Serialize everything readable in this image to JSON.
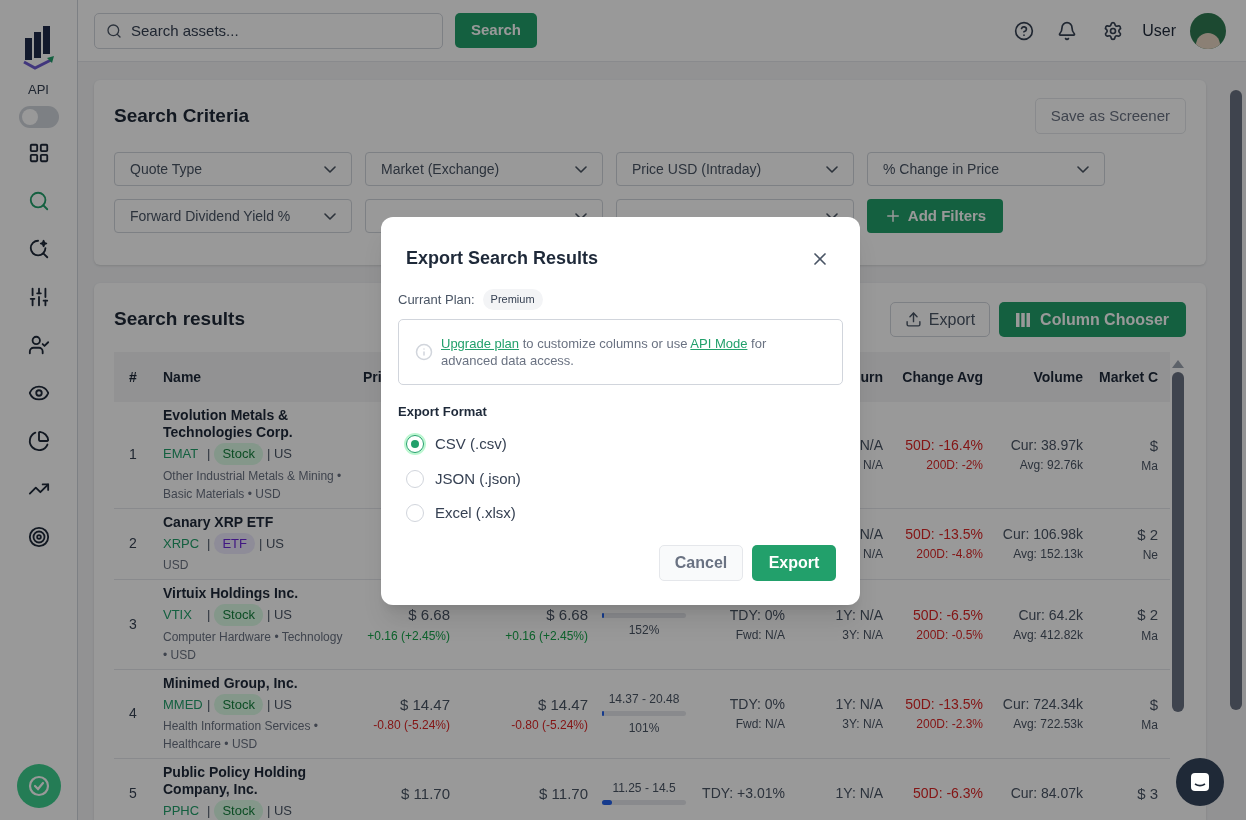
{
  "sidebar": {
    "api_label": "API",
    "api_toggle": {
      "on": false
    },
    "nav": [
      {
        "kind": "grid",
        "selected": false
      },
      {
        "kind": "search",
        "selected": true
      },
      {
        "kind": "search-sparkle",
        "selected": false
      },
      {
        "kind": "sliders",
        "selected": false
      },
      {
        "kind": "user-check",
        "selected": false
      },
      {
        "kind": "eye",
        "selected": false
      },
      {
        "kind": "pie",
        "selected": false
      },
      {
        "kind": "trend",
        "selected": false
      },
      {
        "kind": "target",
        "selected": false
      }
    ]
  },
  "topbar": {
    "search": {
      "placeholder": "Search assets..."
    },
    "search_button": "Search",
    "user": "User"
  },
  "criteria": {
    "title": "Search Criteria",
    "save_button": {
      "label": "Save as Screener",
      "disabled": true
    },
    "filters": [
      {
        "kind": "dropdown",
        "label": "Quote Type"
      },
      {
        "kind": "dropdown",
        "label": "Market (Exchange)"
      },
      {
        "kind": "dropdown",
        "label": "Price USD (Intraday)"
      },
      {
        "kind": "dropdown",
        "label": "% Change in Price"
      },
      {
        "kind": "dropdown",
        "label": "Forward Dividend Yield %"
      },
      {
        "kind": "dropdown"
      },
      {
        "kind": "dropdown"
      }
    ],
    "add_button": "Add Filters"
  },
  "results": {
    "title": "Search results",
    "export_button": "Export",
    "chooser_button": "Column Chooser",
    "columns": [
      "#",
      "Name",
      "Pri",
      "urn",
      "Change Avg",
      "Volume",
      "Market C"
    ],
    "rows": [
      {
        "num": "1",
        "name": "Evolution Metals & Technologies Corp.",
        "ticker": "EMAT",
        "sep": "|",
        "type": {
          "label": "Stock",
          "kind": "stock"
        },
        "country": "| US",
        "sector": "Other Industrial Metals & Mining • Basic Materials • USD",
        "return": {
          "y1": "N/A",
          "y3": "N/A"
        },
        "change_avg": {
          "d50": "50D: -16.4%",
          "d200": "200D: -2%",
          "kind": "loss"
        },
        "volume": {
          "cur": "Cur: 38.97k",
          "avg": "Avg: 92.76k"
        },
        "market_cap": {
          "value": "$",
          "sub": "Ma"
        }
      },
      {
        "num": "2",
        "name": "Canary XRP ETF",
        "ticker": "XRPC",
        "sep": "|",
        "type": {
          "label": "ETF",
          "kind": "etf"
        },
        "country": "| US",
        "sector": "USD",
        "return": {
          "y1": "N/A",
          "y3": "N/A"
        },
        "change_avg": {
          "d50": "50D: -13.5%",
          "d200": "200D: -4.8%",
          "kind": "loss"
        },
        "volume": {
          "cur": "Cur: 106.98k",
          "avg": "Avg: 152.13k"
        },
        "market_cap": {
          "value": "$ 2",
          "sub": "Ne"
        }
      },
      {
        "num": "3",
        "name": "Virtuix Holdings Inc.",
        "ticker": "VTIX",
        "sep": "|",
        "type": {
          "label": "Stock",
          "kind": "stock"
        },
        "country": "| US",
        "sector": "Computer Hardware • Technology • USD",
        "price": {
          "value": "$ 6.68",
          "change": "+0.16 (+2.45%)",
          "kind": "gain"
        },
        "price2": {
          "value": "$ 6.68",
          "change": "+0.16 (+2.45%)",
          "kind": "gain"
        },
        "range": {
          "level": 0.02,
          "pct": "152%"
        },
        "dividend": {
          "tdy": "TDY: 0%",
          "fwd": "Fwd: N/A"
        },
        "return": {
          "y1": "1Y: N/A",
          "y3": "3Y: N/A"
        },
        "change_avg": {
          "d50": "50D: -6.5%",
          "d200": "200D: -0.5%",
          "kind": "loss"
        },
        "volume": {
          "cur": "Cur: 64.2k",
          "avg": "Avg: 412.82k"
        },
        "market_cap": {
          "value": "$ 2",
          "sub": "Ma"
        }
      },
      {
        "num": "4",
        "name": "Minimed Group, Inc.",
        "ticker": "MMED",
        "sep": "|",
        "type": {
          "label": "Stock",
          "kind": "stock"
        },
        "country": "| US",
        "sector": "Health Information Services • Healthcare • USD",
        "price": {
          "value": "$ 14.47",
          "change": "-0.80 (-5.24%)",
          "kind": "loss"
        },
        "price2": {
          "value": "$ 14.47",
          "change": "-0.80 (-5.24%)",
          "kind": "loss"
        },
        "range": {
          "label": "14.37 - 20.48",
          "level": 0.02,
          "pct": "101%"
        },
        "dividend": {
          "tdy": "TDY: 0%",
          "fwd": "Fwd: N/A"
        },
        "return": {
          "y1": "1Y: N/A",
          "y3": "3Y: N/A"
        },
        "change_avg": {
          "d50": "50D: -13.5%",
          "d200": "200D: -2.3%",
          "kind": "loss"
        },
        "volume": {
          "cur": "Cur: 724.34k",
          "avg": "Avg: 722.53k"
        },
        "market_cap": {
          "value": "$",
          "sub": "Ma"
        }
      },
      {
        "num": "5",
        "name": "Public Policy Holding Company, Inc.",
        "ticker": "PPHC",
        "sep": "|",
        "type": {
          "label": "Stock",
          "kind": "stock"
        },
        "country": "| US",
        "price": {
          "value": "$ 11.70"
        },
        "price2": {
          "value": "$ 11.70"
        },
        "range": {
          "label": "11.25 - 14.5",
          "level": 0.12
        },
        "dividend": {
          "tdy": "TDY: +3.01%"
        },
        "return": {
          "y1": "1Y: N/A"
        },
        "change_avg": {
          "d50": "50D: -6.3%",
          "kind": "loss"
        },
        "volume": {
          "cur": "Cur: 84.07k"
        },
        "market_cap": {
          "value": "$ 3"
        }
      }
    ]
  },
  "modal": {
    "title": "Export Search Results",
    "plan_label": "Currant Plan:",
    "plan": "Premium",
    "notice": [
      {
        "kind": "link",
        "text": "Upgrade plan"
      },
      {
        "kind": "text",
        "text": "to customize columns or use"
      },
      {
        "kind": "link",
        "text": "API Mode"
      },
      {
        "kind": "text",
        "text": "for advanced data access."
      }
    ],
    "format_label": "Export Format",
    "options": [
      {
        "label": "CSV (.csv)",
        "selected": true
      },
      {
        "label": "JSON (.json)",
        "selected": false
      },
      {
        "label": "Excel (.xlsx)",
        "selected": false
      }
    ],
    "cancel": "Cancel",
    "export": "Export"
  }
}
